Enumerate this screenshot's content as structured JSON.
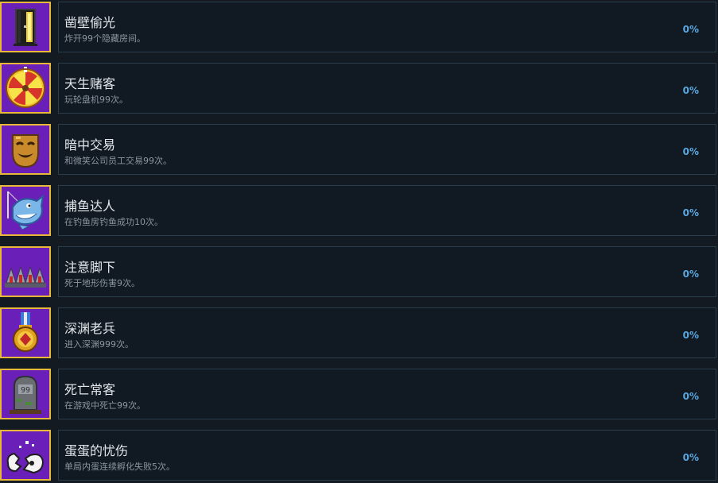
{
  "achievements": [
    {
      "icon": "door-icon",
      "title": "凿壁偷光",
      "desc": "炸开99个隐藏房间。",
      "progress": "0%"
    },
    {
      "icon": "roulette-wheel-icon",
      "title": "天生赌客",
      "desc": "玩轮盘机99次。",
      "progress": "0%"
    },
    {
      "icon": "smiling-mask-icon",
      "title": "暗中交易",
      "desc": "和微笑公司员工交易99次。",
      "progress": "0%"
    },
    {
      "icon": "shark-fishing-icon",
      "title": "捕鱼达人",
      "desc": "在钓鱼房钓鱼成功10次。",
      "progress": "0%"
    },
    {
      "icon": "floor-spikes-icon",
      "title": "注意脚下",
      "desc": "死于地形伤害9次。",
      "progress": "0%"
    },
    {
      "icon": "medal-icon",
      "title": "深渊老兵",
      "desc": "进入深渊999次。",
      "progress": "0%"
    },
    {
      "icon": "gravestone-icon",
      "title": "死亡常客",
      "desc": "在游戏中死亡99次。",
      "progress": "0%"
    },
    {
      "icon": "broken-egg-icon",
      "title": "蛋蛋的忧伤",
      "desc": "单局内蛋连续孵化失败5次。",
      "progress": "0%"
    }
  ],
  "colors": {
    "background": "#141a22",
    "card": "#111922",
    "card_border": "#2a3d4c",
    "icon_frame": "#e8b83a",
    "icon_bg": "#6a20b8",
    "progress_text": "#5ba8e0"
  }
}
